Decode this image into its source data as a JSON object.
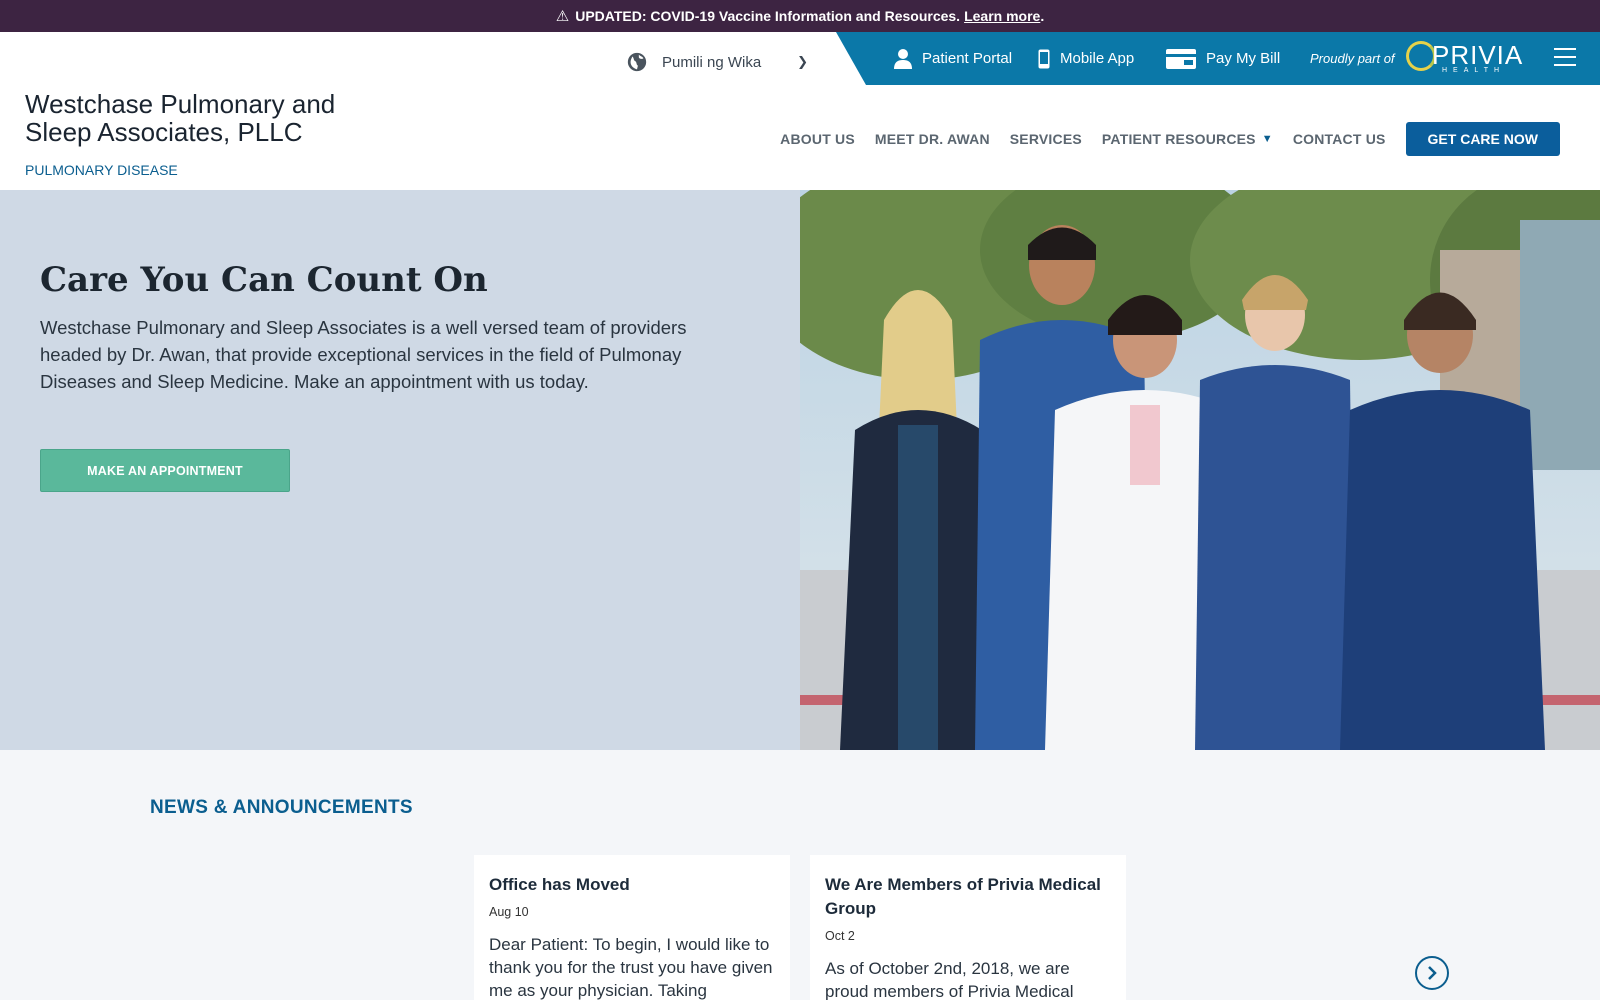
{
  "alert": {
    "icon": "warning-icon",
    "text": "UPDATED: COVID-19 Vaccine Information and Resources.",
    "link": "Learn more",
    "suffix": "."
  },
  "language": {
    "icon": "globe-icon",
    "label": "Pumili ng Wika"
  },
  "utility": {
    "patient_portal": "Patient Portal",
    "mobile_app": "Mobile App",
    "pay_bill": "Pay My Bill",
    "proud": "Proudly part of",
    "logo_word": "PRIVIA",
    "logo_sub": "HEALTH"
  },
  "brand": {
    "line1": "Westchase Pulmonary and",
    "line2": "Sleep Associates, PLLC",
    "subtitle": "PULMONARY DISEASE"
  },
  "nav": {
    "about": "ABOUT US",
    "meet": "MEET DR. AWAN",
    "services": "SERVICES",
    "resources": "PATIENT RESOURCES",
    "contact": "CONTACT US",
    "cta": "GET CARE NOW"
  },
  "hero": {
    "title": "Care You Can Count On",
    "text": "Westchase Pulmonary and Sleep Associates is a well versed team of providers headed by Dr. Awan, that provide exceptional services in the field of Pulmonay Diseases and Sleep Medicine. Make an appointment with us today.",
    "button": "MAKE AN APPOINTMENT"
  },
  "news": {
    "title": "NEWS & ANNOUNCEMENTS",
    "cards": [
      {
        "title": "Office has Moved",
        "date": "Aug 10",
        "excerpt": "Dear Patient: To begin, I would like to thank you for the trust you have given me as your physician. Taking"
      },
      {
        "title": "We Are Members of Privia Medical Group",
        "date": "Oct 2",
        "excerpt": "As of October 2nd, 2018, we are proud members of Privia Medical"
      }
    ]
  },
  "colors": {
    "alert_bg": "#3d2442",
    "utility_bg": "#0b78a8",
    "cta_bg": "#0b5e9c",
    "hero_bg": "#cfd9e5",
    "appointment_btn": "#5ab89b"
  }
}
